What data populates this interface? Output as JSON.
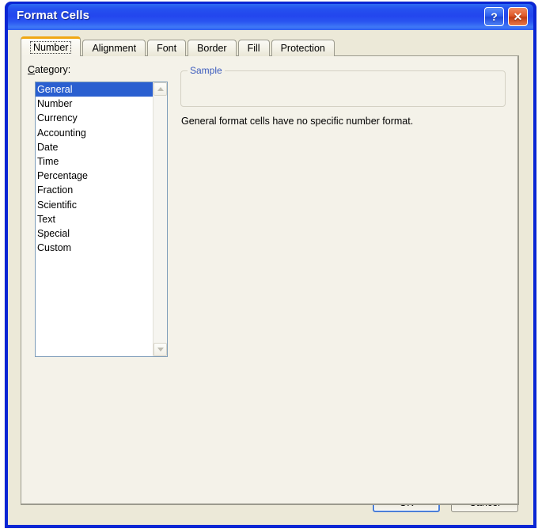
{
  "window": {
    "title": "Format Cells",
    "help_button": "?",
    "close_button": "✕",
    "accent_titlebar": "#2346ee",
    "accent_close": "#c03c12",
    "client_background": "#ece9d8",
    "panel_background": "#f4f2e9"
  },
  "tabs": [
    {
      "label": "Number",
      "active": true
    },
    {
      "label": "Alignment",
      "active": false
    },
    {
      "label": "Font",
      "active": false
    },
    {
      "label": "Border",
      "active": false
    },
    {
      "label": "Fill",
      "active": false
    },
    {
      "label": "Protection",
      "active": false
    }
  ],
  "number_tab": {
    "category_label_prefix": "C",
    "category_label_rest": "ategory:",
    "categories": [
      "General",
      "Number",
      "Currency",
      "Accounting",
      "Date",
      "Time",
      "Percentage",
      "Fraction",
      "Scientific",
      "Text",
      "Special",
      "Custom"
    ],
    "selected_category": "General",
    "selection_color": "#2a5fd0",
    "sample": {
      "legend": "Sample",
      "legend_color": "#3b5bbd",
      "value": ""
    },
    "description": "General format cells have no specific number format."
  },
  "footer": {
    "ok_label": "OK",
    "cancel_label": "Cancel",
    "default_button": "OK",
    "default_border_color": "#4a7ed8"
  }
}
